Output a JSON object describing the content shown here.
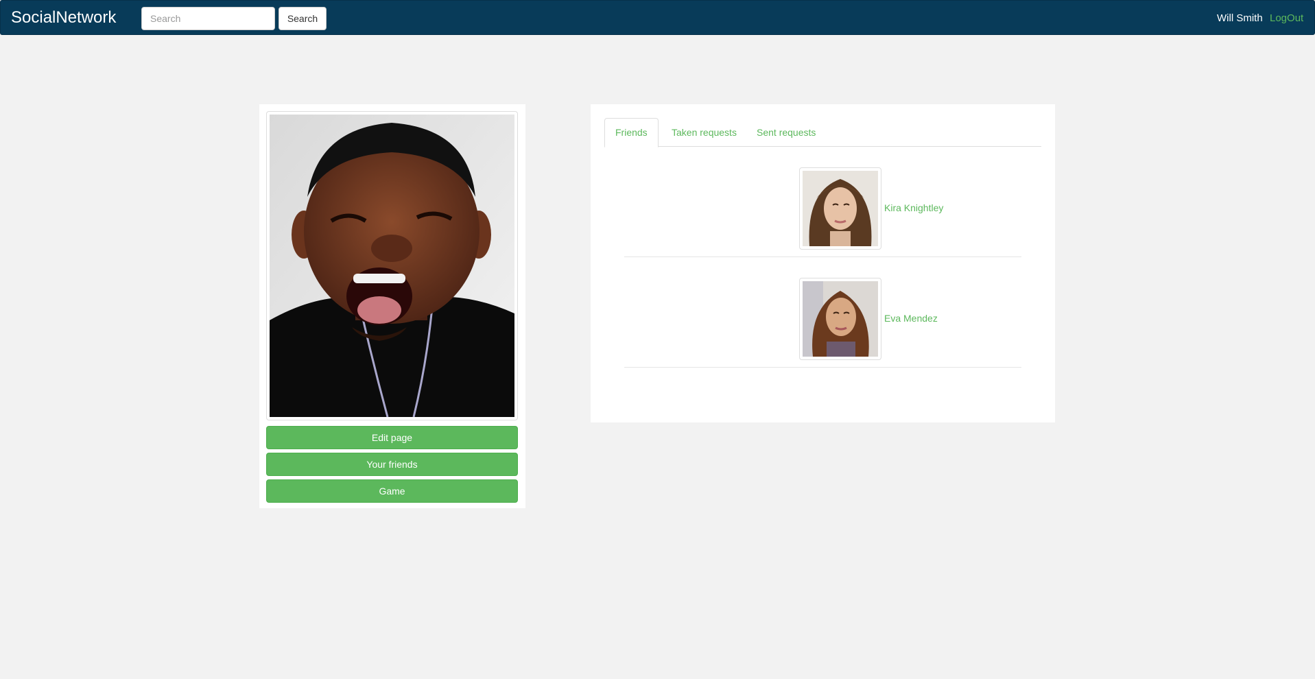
{
  "navbar": {
    "brand": "SocialNetwork",
    "search_placeholder": "Search",
    "search_button": "Search",
    "user_name": "Will Smith",
    "logout": "LogOut"
  },
  "profile": {
    "buttons": {
      "edit": "Edit page",
      "friends": "Your friends",
      "game": "Game"
    }
  },
  "friends_panel": {
    "tabs": [
      "Friends",
      "Taken requests",
      "Sent requests"
    ],
    "active_tab": "Friends",
    "friends": [
      {
        "name": "Kira Knightley"
      },
      {
        "name": "Eva Mendez"
      }
    ]
  },
  "colors": {
    "navbar_bg": "#083b59",
    "accent_green": "#5cb85c",
    "page_bg": "#f2f2f2"
  }
}
